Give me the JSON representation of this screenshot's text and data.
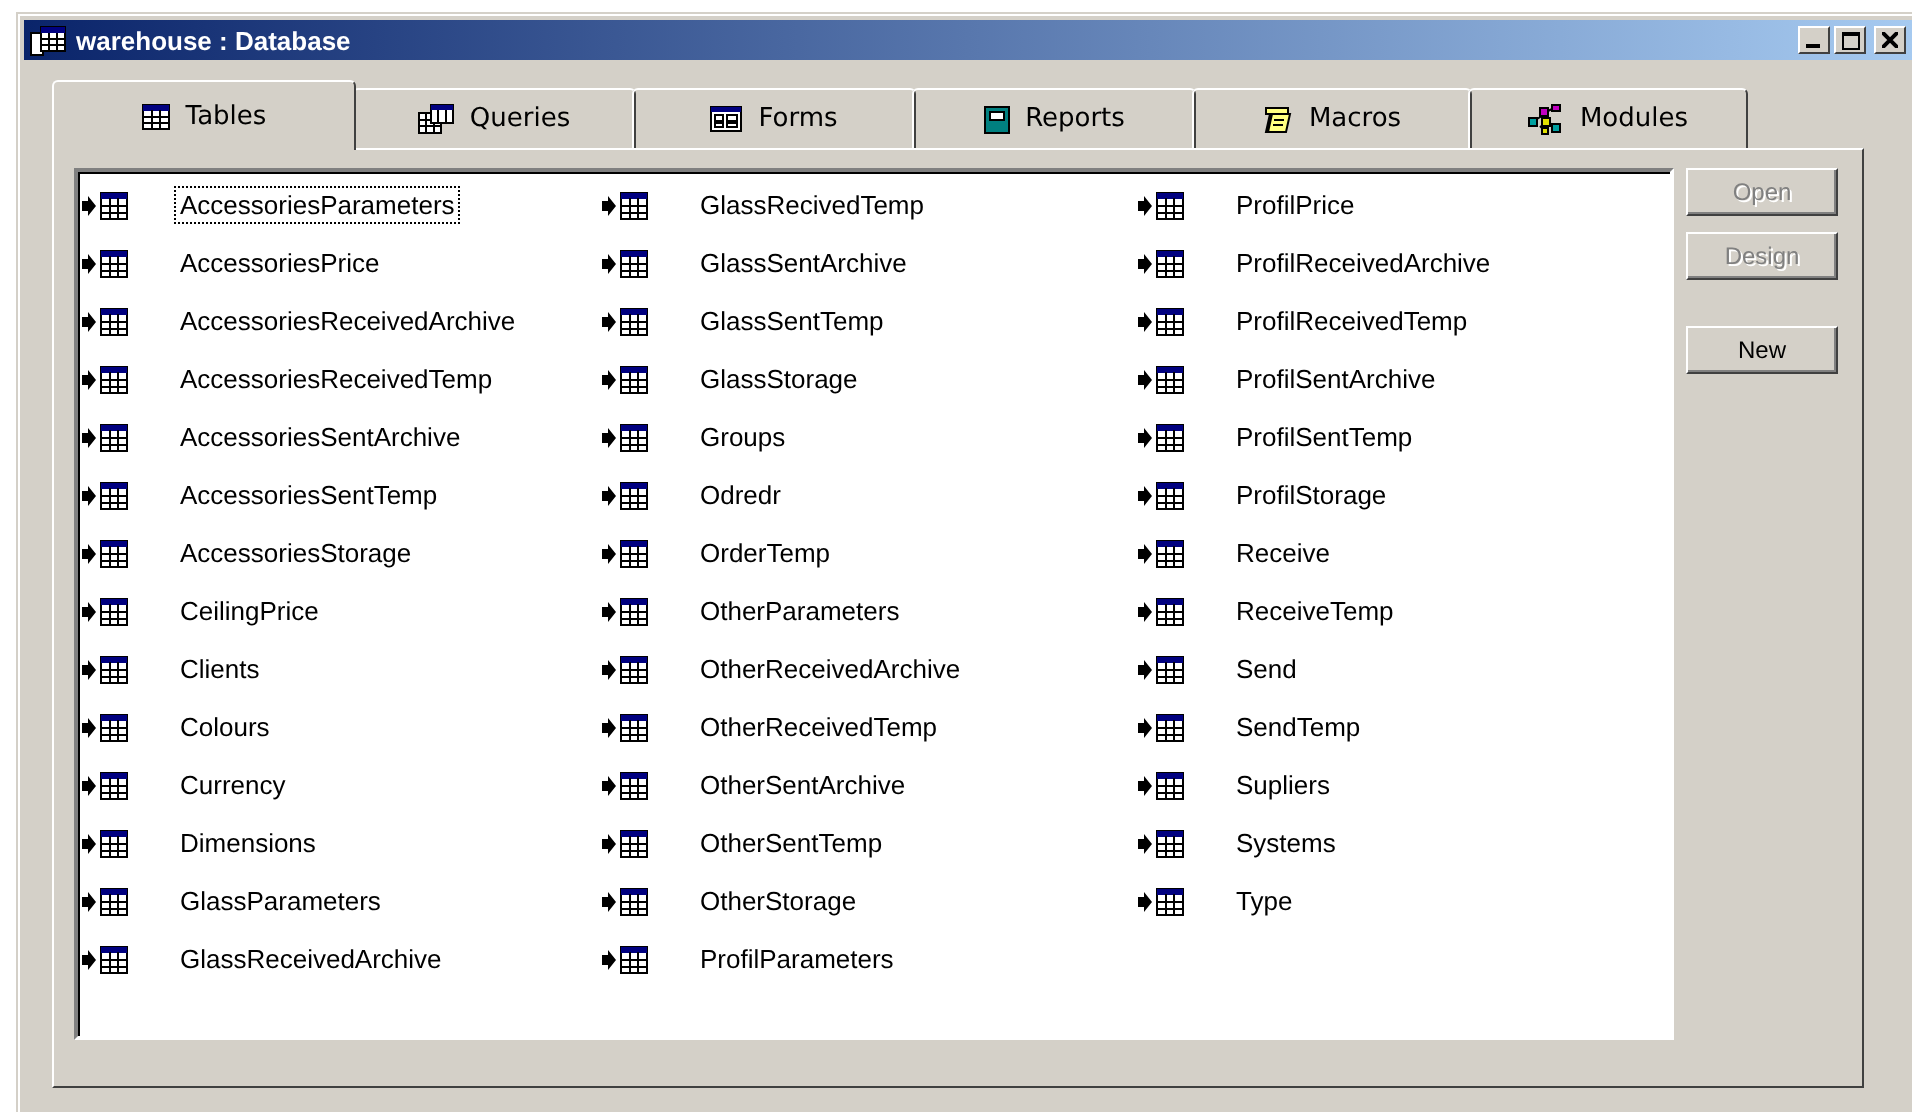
{
  "window": {
    "title": "warehouse : Database"
  },
  "tabs": [
    {
      "label": "Tables",
      "kind": "tables",
      "selected": true
    },
    {
      "label": "Queries",
      "kind": "queries",
      "selected": false
    },
    {
      "label": "Forms",
      "kind": "forms",
      "selected": false
    },
    {
      "label": "Reports",
      "kind": "reports",
      "selected": false
    },
    {
      "label": "Macros",
      "kind": "macros",
      "selected": false
    },
    {
      "label": "Modules",
      "kind": "modules",
      "selected": false
    }
  ],
  "items": [
    {
      "name": "AccessoriesParameters",
      "selected": true
    },
    {
      "name": "AccessoriesPrice",
      "selected": false
    },
    {
      "name": "AccessoriesReceivedArchive",
      "selected": false
    },
    {
      "name": "AccessoriesReceivedTemp",
      "selected": false
    },
    {
      "name": "AccessoriesSentArchive",
      "selected": false
    },
    {
      "name": "AccessoriesSentTemp",
      "selected": false
    },
    {
      "name": "AccessoriesStorage",
      "selected": false
    },
    {
      "name": "CeilingPrice",
      "selected": false
    },
    {
      "name": "Clients",
      "selected": false
    },
    {
      "name": "Colours",
      "selected": false
    },
    {
      "name": "Currency",
      "selected": false
    },
    {
      "name": "Dimensions",
      "selected": false
    },
    {
      "name": "GlassParameters",
      "selected": false
    },
    {
      "name": "GlassReceivedArchive",
      "selected": false
    },
    {
      "name": "GlassRecivedTemp",
      "selected": false
    },
    {
      "name": "GlassSentArchive",
      "selected": false
    },
    {
      "name": "GlassSentTemp",
      "selected": false
    },
    {
      "name": "GlassStorage",
      "selected": false
    },
    {
      "name": "Groups",
      "selected": false
    },
    {
      "name": "Odredr",
      "selected": false
    },
    {
      "name": "OrderTemp",
      "selected": false
    },
    {
      "name": "OtherParameters",
      "selected": false
    },
    {
      "name": "OtherReceivedArchive",
      "selected": false
    },
    {
      "name": "OtherReceivedTemp",
      "selected": false
    },
    {
      "name": "OtherSentArchive",
      "selected": false
    },
    {
      "name": "OtherSentTemp",
      "selected": false
    },
    {
      "name": "OtherStorage",
      "selected": false
    },
    {
      "name": "ProfilParameters",
      "selected": false
    },
    {
      "name": "ProfilPrice",
      "selected": false
    },
    {
      "name": "ProfilReceivedArchive",
      "selected": false
    },
    {
      "name": "ProfilReceivedTemp",
      "selected": false
    },
    {
      "name": "ProfilSentArchive",
      "selected": false
    },
    {
      "name": "ProfilSentTemp",
      "selected": false
    },
    {
      "name": "ProfilStorage",
      "selected": false
    },
    {
      "name": "Receive",
      "selected": false
    },
    {
      "name": "ReceiveTemp",
      "selected": false
    },
    {
      "name": "Send",
      "selected": false
    },
    {
      "name": "SendTemp",
      "selected": false
    },
    {
      "name": "Supliers",
      "selected": false
    },
    {
      "name": "Systems",
      "selected": false
    },
    {
      "name": "Type",
      "selected": false
    }
  ],
  "buttons": [
    {
      "label": "Open",
      "disabled": true
    },
    {
      "label": "Design",
      "disabled": true
    },
    {
      "label": "New",
      "disabled": false
    }
  ]
}
